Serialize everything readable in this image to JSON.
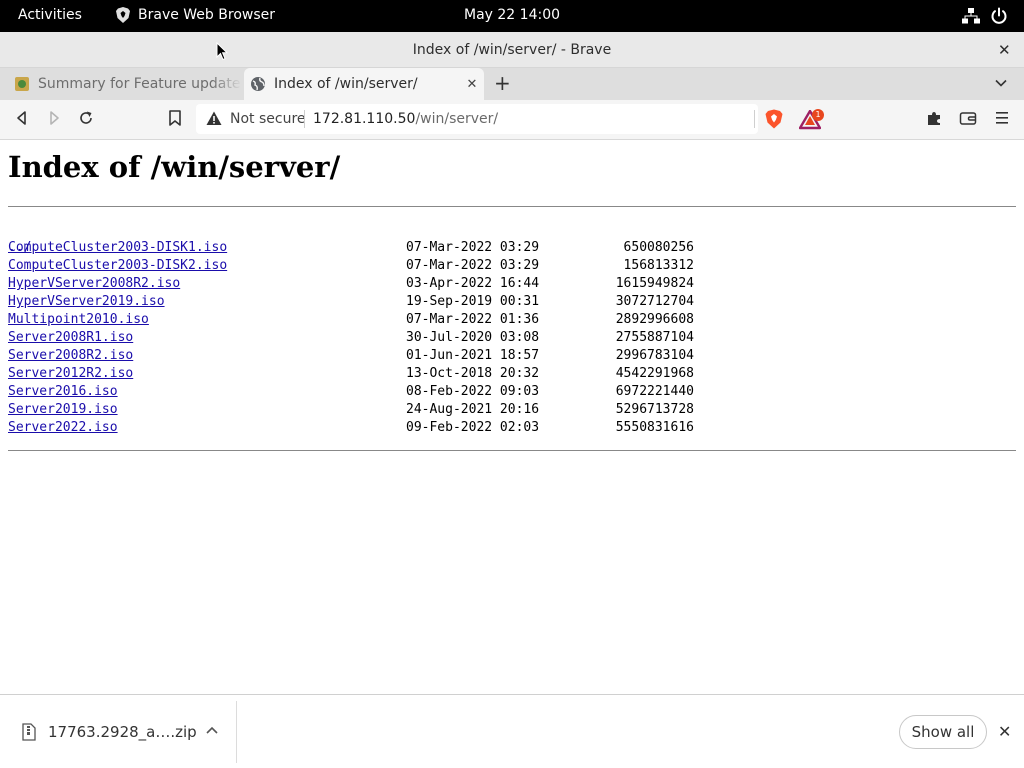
{
  "system_bar": {
    "activities": "Activities",
    "app_name": "Brave Web Browser",
    "clock": "May 22  14:00",
    "icons": [
      "network-icon",
      "power-icon"
    ]
  },
  "window": {
    "title": "Index of /win/server/ - Brave",
    "close_icon": "close-icon"
  },
  "tabs": [
    {
      "title": "Summary for Feature update to",
      "favicon": "feature-update-icon",
      "active": false
    },
    {
      "title": "Index of /win/server/",
      "favicon": "globe-icon",
      "active": true
    }
  ],
  "toolbar": {
    "security_label": "Not secure",
    "url_host": "172.81.110.50",
    "url_path": "/win/server/",
    "rewards_badge": "1",
    "icons": [
      "back-icon",
      "forward-icon",
      "reload-icon",
      "bookmark-icon",
      "warning-icon",
      "brave-shield-icon",
      "brave-rewards-icon",
      "extensions-icon",
      "wallet-icon",
      "menu-icon"
    ]
  },
  "page": {
    "heading": "Index of /win/server/",
    "parent_link": "../",
    "files": [
      {
        "name": "ComputeCluster2003-DISK1.iso",
        "date": "07-Mar-2022 03:29",
        "size": "650080256"
      },
      {
        "name": "ComputeCluster2003-DISK2.iso",
        "date": "07-Mar-2022 03:29",
        "size": "156813312"
      },
      {
        "name": "HyperVServer2008R2.iso",
        "date": "03-Apr-2022 16:44",
        "size": "1615949824"
      },
      {
        "name": "HyperVServer2019.iso",
        "date": "19-Sep-2019 00:31",
        "size": "3072712704"
      },
      {
        "name": "Multipoint2010.iso",
        "date": "07-Mar-2022 01:36",
        "size": "2892996608"
      },
      {
        "name": "Server2008R1.iso",
        "date": "30-Jul-2020 03:08",
        "size": "2755887104"
      },
      {
        "name": "Server2008R2.iso",
        "date": "01-Jun-2021 18:57",
        "size": "2996783104"
      },
      {
        "name": "Server2012R2.iso",
        "date": "13-Oct-2018 20:32",
        "size": "4542291968"
      },
      {
        "name": "Server2016.iso",
        "date": "08-Feb-2022 09:03",
        "size": "6972221440"
      },
      {
        "name": "Server2019.iso",
        "date": "24-Aug-2021 20:16",
        "size": "5296713728"
      },
      {
        "name": "Server2022.iso",
        "date": "09-Feb-2022 02:03",
        "size": "5550831616"
      }
    ]
  },
  "downloads": {
    "filename": "17763.2928_a….zip",
    "show_all": "Show all"
  },
  "colors": {
    "link": "#1a0dab",
    "brave_orange": "#fb542b",
    "top_bar": "#000000"
  }
}
